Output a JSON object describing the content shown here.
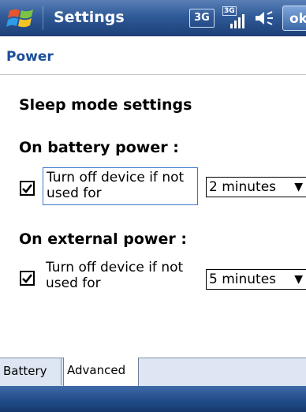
{
  "title_bar": {
    "app_title": "Settings",
    "network_label": "3G",
    "signal_label": "3G",
    "ok_label": "ok"
  },
  "header": {
    "title": "Power"
  },
  "content": {
    "section_title": "Sleep mode settings",
    "battery": {
      "heading": "On battery power :",
      "option_label": "Turn off device if not used for",
      "checked": true,
      "dropdown_value": "2 minutes"
    },
    "external": {
      "heading": "On external power :",
      "option_label": "Turn off device if not used for",
      "checked": true,
      "dropdown_value": "5 minutes"
    }
  },
  "tabs": [
    {
      "label": "Battery",
      "active": false
    },
    {
      "label": "Advanced",
      "active": true
    }
  ],
  "icons": {
    "start": "windows-flag-icon",
    "signal": "signal-strength-icon",
    "volume": "speaker-icon",
    "dropdown": "down-arrow-icon",
    "checkbox": "checkmark-icon"
  },
  "colors": {
    "titlebar": "#2f5a98",
    "header_text": "#1b4f9a",
    "focus_border": "#3a78c9"
  }
}
